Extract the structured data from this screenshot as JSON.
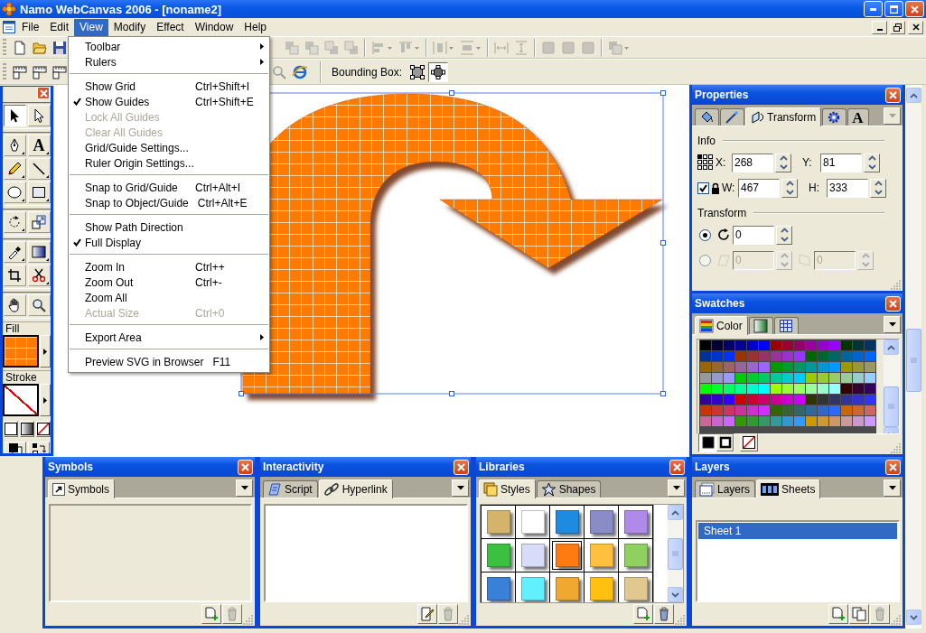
{
  "window": {
    "title": "Namo WebCanvas 2006 - [noname2]"
  },
  "menu_bar": [
    {
      "label": "File",
      "selected": false
    },
    {
      "label": "Edit",
      "selected": false
    },
    {
      "label": "View",
      "selected": true
    },
    {
      "label": "Modify",
      "selected": false
    },
    {
      "label": "Effect",
      "selected": false
    },
    {
      "label": "Window",
      "selected": false
    },
    {
      "label": "Help",
      "selected": false
    }
  ],
  "toolbar": {
    "rows": [
      [
        {
          "kind": "new",
          "disabled": false
        },
        {
          "kind": "open",
          "disabled": false
        },
        {
          "kind": "save",
          "disabled": false
        },
        {
          "kind": "front",
          "disabled": true
        },
        {
          "kind": "forward",
          "disabled": true
        },
        {
          "kind": "backward",
          "disabled": true
        },
        {
          "kind": "back",
          "disabled": true
        },
        {
          "kind": "separator"
        },
        {
          "kind": "align_h",
          "disabled": true
        },
        {
          "kind": "align_v",
          "disabled": true
        },
        {
          "kind": "separator"
        },
        {
          "kind": "distribute_h",
          "disabled": true
        },
        {
          "kind": "distribute_v",
          "disabled": true
        },
        {
          "kind": "separator"
        },
        {
          "kind": "space_h",
          "disabled": true
        },
        {
          "kind": "space_v",
          "disabled": true
        },
        {
          "kind": "separator"
        },
        {
          "kind": "same_width",
          "disabled": true
        },
        {
          "kind": "same_height",
          "disabled": true
        },
        {
          "kind": "same_size",
          "disabled": true
        },
        {
          "kind": "separator"
        },
        {
          "kind": "group",
          "disabled": true
        }
      ],
      [
        {
          "kind": "ruler_h",
          "disabled": false
        },
        {
          "kind": "ruler_v",
          "disabled": false
        },
        {
          "kind": "ruler_both",
          "disabled": false
        },
        {
          "kind": "zoom",
          "disabled": true
        },
        {
          "kind": "preview",
          "disabled": false
        }
      ]
    ],
    "bounding_box_label": "Bounding Box:",
    "bounding_box_modes": [
      {
        "selected": false
      },
      {
        "selected": true
      }
    ]
  },
  "view_menu": [
    {
      "kind": "item",
      "label": "Toolbar",
      "checked": false,
      "disabled": false,
      "submenu": true
    },
    {
      "kind": "item",
      "label": "Rulers",
      "checked": false,
      "disabled": false,
      "submenu": true
    },
    {
      "kind": "separator"
    },
    {
      "kind": "item",
      "label": "Show Grid",
      "shortcut": "Ctrl+Shift+I",
      "checked": false,
      "disabled": false,
      "submenu": false
    },
    {
      "kind": "item",
      "label": "Show Guides",
      "shortcut": "Ctrl+Shift+E",
      "checked": true,
      "disabled": false,
      "submenu": false
    },
    {
      "kind": "item",
      "label": "Lock All Guides",
      "checked": false,
      "disabled": true,
      "submenu": false
    },
    {
      "kind": "item",
      "label": "Clear All Guides",
      "checked": false,
      "disabled": true,
      "submenu": false
    },
    {
      "kind": "item",
      "label": "Grid/Guide Settings...",
      "checked": false,
      "disabled": false,
      "submenu": false
    },
    {
      "kind": "item",
      "label": "Ruler Origin Settings...",
      "checked": false,
      "disabled": false,
      "submenu": false
    },
    {
      "kind": "separator"
    },
    {
      "kind": "item",
      "label": "Snap to Grid/Guide",
      "shortcut": "Ctrl+Alt+I",
      "checked": false,
      "disabled": false,
      "submenu": false
    },
    {
      "kind": "item",
      "label": "Snap to Object/Guide",
      "shortcut": "Ctrl+Alt+E",
      "checked": false,
      "disabled": false,
      "submenu": false
    },
    {
      "kind": "separator"
    },
    {
      "kind": "item",
      "label": "Show Path Direction",
      "checked": false,
      "disabled": false,
      "submenu": false
    },
    {
      "kind": "item",
      "label": "Full Display",
      "checked": true,
      "disabled": false,
      "submenu": false
    },
    {
      "kind": "separator"
    },
    {
      "kind": "item",
      "label": "Zoom In",
      "shortcut": "Ctrl++",
      "checked": false,
      "disabled": false,
      "submenu": false
    },
    {
      "kind": "item",
      "label": "Zoom Out",
      "shortcut": "Ctrl+-",
      "checked": false,
      "disabled": false,
      "submenu": false
    },
    {
      "kind": "item",
      "label": "Zoom All",
      "checked": false,
      "disabled": false,
      "submenu": false
    },
    {
      "kind": "item",
      "label": "Actual Size",
      "shortcut": "Ctrl+0",
      "checked": false,
      "disabled": true,
      "submenu": false
    },
    {
      "kind": "separator"
    },
    {
      "kind": "item",
      "label": "Export Area",
      "checked": false,
      "disabled": false,
      "submenu": true
    },
    {
      "kind": "separator"
    },
    {
      "kind": "item",
      "label": "Preview SVG in Browser",
      "shortcut": "F11",
      "checked": false,
      "disabled": false,
      "submenu": false
    }
  ],
  "toolbox": {
    "tools": [
      {
        "kind": "select",
        "selected": true,
        "flyout": false
      },
      {
        "kind": "subselect",
        "selected": false,
        "flyout": false
      },
      {
        "kind": "pen",
        "selected": false,
        "flyout": true
      },
      {
        "kind": "text",
        "glyph": "A",
        "selected": false,
        "flyout": true
      },
      {
        "kind": "pencil",
        "selected": false,
        "flyout": true
      },
      {
        "kind": "line",
        "selected": false,
        "flyout": true
      },
      {
        "kind": "ellipse",
        "selected": false,
        "flyout": true
      },
      {
        "kind": "rectangle",
        "selected": false,
        "flyout": true
      },
      {
        "kind": "rotate",
        "selected": false,
        "flyout": true
      },
      {
        "kind": "scale",
        "selected": false,
        "flyout": false
      },
      {
        "kind": "eyedropper",
        "selected": false,
        "flyout": true
      },
      {
        "kind": "gradient",
        "selected": false,
        "flyout": true
      },
      {
        "kind": "crop",
        "selected": false,
        "flyout": false
      },
      {
        "kind": "scissors",
        "selected": false,
        "flyout": true
      },
      {
        "kind": "hand",
        "selected": false,
        "flyout": false
      },
      {
        "kind": "zoom",
        "selected": false,
        "flyout": false
      }
    ],
    "fill_label": "Fill",
    "stroke_label": "Stroke"
  },
  "properties": {
    "title": "Properties",
    "menu_disabled": true,
    "tabs": [
      {
        "kind": "fill",
        "selected": false
      },
      {
        "kind": "stroke",
        "selected": false
      },
      {
        "kind": "transform",
        "label": "Transform",
        "selected": true
      },
      {
        "kind": "settings",
        "selected": false
      },
      {
        "kind": "text",
        "glyph": "A",
        "selected": false
      }
    ],
    "info_label": "Info",
    "fields": [
      {
        "label": "X:",
        "value": "268"
      },
      {
        "label": "Y:",
        "value": "81"
      },
      {
        "label": "W:",
        "value": "467"
      },
      {
        "label": "H:",
        "value": "333"
      }
    ],
    "lock_checked": true,
    "transform_label": "Transform",
    "rotate": {
      "selected": true,
      "value": "0"
    },
    "skew": {
      "selected": false,
      "disabled": true,
      "values": [
        "0",
        "0"
      ]
    }
  },
  "swatches": {
    "title": "Swatches",
    "menu_disabled": false,
    "tabs": [
      {
        "kind": "color",
        "label": "Color",
        "selected": true
      },
      {
        "kind": "gradient",
        "selected": false
      },
      {
        "kind": "pattern",
        "selected": false
      }
    ],
    "rows": [
      [
        {
          "color": "#000000"
        },
        {
          "color": "#000033"
        },
        {
          "color": "#000066"
        },
        {
          "color": "#000099"
        },
        {
          "color": "#0000cc"
        },
        {
          "color": "#0000ff"
        },
        {
          "color": "#990000"
        },
        {
          "color": "#990033"
        },
        {
          "color": "#990066"
        },
        {
          "color": "#990099"
        },
        {
          "color": "#9900cc"
        },
        {
          "color": "#9900ff"
        },
        {
          "color": "#003300"
        },
        {
          "color": "#003333"
        },
        {
          "color": "#003366"
        }
      ],
      [
        {
          "color": "#003399"
        },
        {
          "color": "#0033cc"
        },
        {
          "color": "#0033ff"
        },
        {
          "color": "#993300"
        },
        {
          "color": "#993333"
        },
        {
          "color": "#993366"
        },
        {
          "color": "#993399"
        },
        {
          "color": "#9933cc"
        },
        {
          "color": "#9933ff"
        },
        {
          "color": "#006600"
        },
        {
          "color": "#006633"
        },
        {
          "color": "#006666"
        },
        {
          "color": "#006699"
        },
        {
          "color": "#0066cc"
        },
        {
          "color": "#0066ff"
        }
      ],
      [
        {
          "color": "#996600"
        },
        {
          "color": "#996633"
        },
        {
          "color": "#996666"
        },
        {
          "color": "#996699"
        },
        {
          "color": "#9966cc"
        },
        {
          "color": "#9966ff"
        },
        {
          "color": "#009900"
        },
        {
          "color": "#009933"
        },
        {
          "color": "#009966"
        },
        {
          "color": "#009999"
        },
        {
          "color": "#0099cc"
        },
        {
          "color": "#0099ff"
        },
        {
          "color": "#999900"
        },
        {
          "color": "#999933"
        },
        {
          "color": "#999966"
        }
      ],
      [
        {
          "color": "#999999"
        },
        {
          "color": "#9999cc"
        },
        {
          "color": "#9999ff"
        },
        {
          "color": "#00cc00"
        },
        {
          "color": "#00cc33"
        },
        {
          "color": "#00cc66"
        },
        {
          "color": "#00cc99"
        },
        {
          "color": "#00cccc"
        },
        {
          "color": "#00ccff"
        },
        {
          "color": "#99cc00"
        },
        {
          "color": "#99cc33"
        },
        {
          "color": "#99cc66"
        },
        {
          "color": "#99cc99"
        },
        {
          "color": "#99cccc"
        },
        {
          "color": "#99ccff"
        }
      ],
      [
        {
          "color": "#00ff00"
        },
        {
          "color": "#00ff33"
        },
        {
          "color": "#00ff66"
        },
        {
          "color": "#00ff99"
        },
        {
          "color": "#00ffcc"
        },
        {
          "color": "#00ffff"
        },
        {
          "color": "#99ff00"
        },
        {
          "color": "#99ff33"
        },
        {
          "color": "#99ff66"
        },
        {
          "color": "#99ff99"
        },
        {
          "color": "#99ffcc"
        },
        {
          "color": "#99ffff"
        },
        {
          "color": "#330000"
        },
        {
          "color": "#330033"
        },
        {
          "color": "#330066"
        }
      ],
      [
        {
          "color": "#330099"
        },
        {
          "color": "#3300cc"
        },
        {
          "color": "#3300ff"
        },
        {
          "color": "#cc0000"
        },
        {
          "color": "#cc0033"
        },
        {
          "color": "#cc0066"
        },
        {
          "color": "#cc0099"
        },
        {
          "color": "#cc00cc"
        },
        {
          "color": "#cc00ff"
        },
        {
          "color": "#333300"
        },
        {
          "color": "#333333"
        },
        {
          "color": "#333366"
        },
        {
          "color": "#333399"
        },
        {
          "color": "#3333cc"
        },
        {
          "color": "#3333ff"
        }
      ],
      [
        {
          "color": "#cc3300"
        },
        {
          "color": "#cc3333"
        },
        {
          "color": "#cc3366"
        },
        {
          "color": "#cc3399"
        },
        {
          "color": "#cc33cc"
        },
        {
          "color": "#cc33ff"
        },
        {
          "color": "#336600"
        },
        {
          "color": "#336633"
        },
        {
          "color": "#336666"
        },
        {
          "color": "#336699"
        },
        {
          "color": "#3366cc"
        },
        {
          "color": "#3366ff"
        },
        {
          "color": "#cc6600"
        },
        {
          "color": "#cc6633"
        },
        {
          "color": "#cc6666"
        }
      ],
      [
        {
          "color": "#cc6699"
        },
        {
          "color": "#cc66cc"
        },
        {
          "color": "#cc66ff"
        },
        {
          "color": "#339900"
        },
        {
          "color": "#339933"
        },
        {
          "color": "#339966"
        },
        {
          "color": "#339999"
        },
        {
          "color": "#3399cc"
        },
        {
          "color": "#3399ff"
        },
        {
          "color": "#cc9900"
        },
        {
          "color": "#cc9933"
        },
        {
          "color": "#cc9966"
        },
        {
          "color": "#cc9999"
        },
        {
          "color": "#cc99cc"
        },
        {
          "color": "#cc99ff"
        }
      ]
    ],
    "modes": [
      {
        "selected": true
      },
      {
        "selected": false
      }
    ]
  },
  "symbols": {
    "title": "Symbols",
    "menu_disabled": false,
    "tabs": [
      {
        "kind": "symbols",
        "label": "Symbols",
        "selected": true
      }
    ],
    "footer_buttons": [
      {
        "kind": "new",
        "disabled": false
      },
      {
        "kind": "delete",
        "disabled": true
      }
    ]
  },
  "interactivity": {
    "title": "Interactivity",
    "menu_disabled": false,
    "tabs": [
      {
        "kind": "script",
        "label": "Script",
        "selected": false
      },
      {
        "kind": "hyperlink",
        "label": "Hyperlink",
        "selected": true
      }
    ],
    "footer_buttons": [
      {
        "kind": "edit",
        "disabled": false
      },
      {
        "kind": "delete",
        "disabled": true
      }
    ]
  },
  "libraries": {
    "title": "Libraries",
    "menu_disabled": false,
    "tabs": [
      {
        "kind": "styles",
        "label": "Styles",
        "selected": true
      },
      {
        "kind": "shapes",
        "label": "Shapes",
        "selected": false
      }
    ],
    "styles": [
      {
        "color": "#d4b46a",
        "selected": false
      },
      {
        "color": "#ffffff",
        "selected": false
      },
      {
        "color": "#1e8be0",
        "selected": false
      },
      {
        "color": "#8a8cc8",
        "selected": false
      },
      {
        "color": "#b08ae8",
        "selected": false
      },
      {
        "color": "#3cc040",
        "selected": false
      },
      {
        "color": "#d8dcf8",
        "selected": false
      },
      {
        "color": "#ff7a10",
        "selected": true
      },
      {
        "color": "#ffc040",
        "selected": false
      },
      {
        "color": "#90d060",
        "selected": false
      },
      {
        "color": "#3a80d8",
        "selected": false
      },
      {
        "color": "#60f0ff",
        "selected": false
      },
      {
        "color": "#f0a830",
        "selected": false
      },
      {
        "color": "#ffc010",
        "selected": false
      },
      {
        "color": "#e0c890",
        "selected": false
      }
    ],
    "footer_buttons": [
      {
        "kind": "new",
        "disabled": false
      },
      {
        "kind": "delete",
        "disabled": false
      }
    ]
  },
  "layers": {
    "title": "Layers",
    "menu_disabled": false,
    "tabs": [
      {
        "kind": "layers",
        "label": "Layers",
        "selected": false
      },
      {
        "kind": "sheets",
        "label": "Sheets",
        "selected": true
      }
    ],
    "items": [
      {
        "label": "Sheet 1",
        "selected": true
      }
    ],
    "footer_buttons": [
      {
        "kind": "new",
        "disabled": false
      },
      {
        "kind": "duplicate",
        "disabled": false
      },
      {
        "kind": "delete",
        "disabled": true
      }
    ]
  }
}
